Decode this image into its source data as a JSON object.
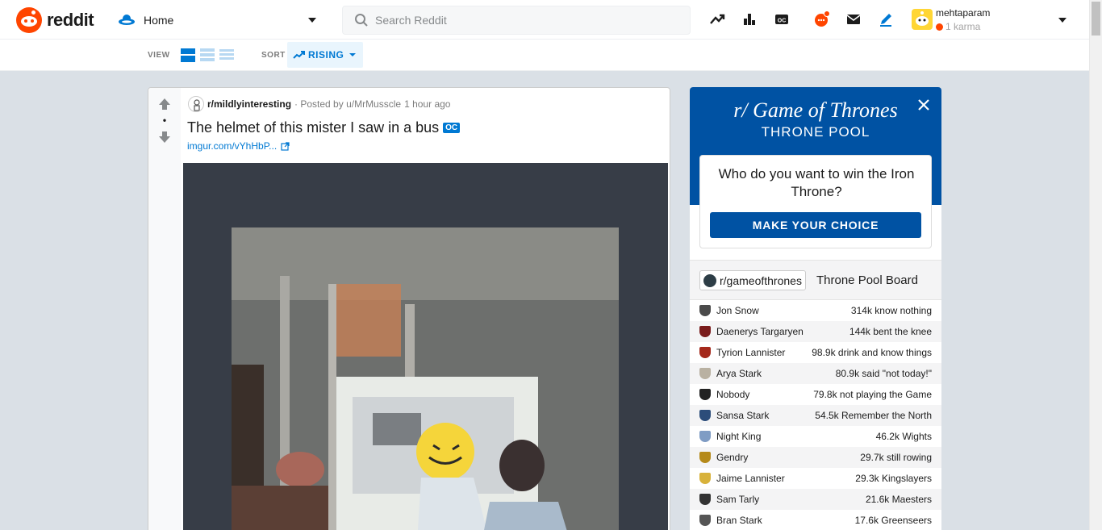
{
  "header": {
    "logo_text": "reddit",
    "home_label": "Home",
    "search_placeholder": "Search Reddit",
    "user": {
      "name": "mehtaparam",
      "karma": "1 karma"
    },
    "icons": [
      "popular-icon",
      "stats-icon",
      "oc-icon",
      "chat-icon",
      "mail-icon",
      "create-post-icon"
    ]
  },
  "subbar": {
    "view_label": "VIEW",
    "sort_label": "SORT",
    "sort_value": "RISING"
  },
  "post": {
    "score": "•",
    "subreddit": "r/mildlyinteresting",
    "posted_by": "· Posted by u/MrMusscle",
    "time": "1 hour ago",
    "title": "The helmet of this mister I saw in a bus",
    "flair": "OC",
    "link": "imgur.com/vYhHbP..."
  },
  "sidebar": {
    "banner_title": "r/ Game of Thrones",
    "banner_sub": "THRONE POOL",
    "question": "Who do you want to win the Iron Throne?",
    "choice_button": "MAKE YOUR CHOICE",
    "board_sub": "r/gameofthrones",
    "board_title": "Throne Pool Board",
    "rows": [
      {
        "name": "Jon Snow",
        "votes": "314k know nothing",
        "color": "#4a4a4a"
      },
      {
        "name": "Daenerys Targaryen",
        "votes": "144k bent the knee",
        "color": "#7a1c1c"
      },
      {
        "name": "Tyrion Lannister",
        "votes": "98.9k drink and know things",
        "color": "#a4281b"
      },
      {
        "name": "Arya Stark",
        "votes": "80.9k said \"not today!\"",
        "color": "#b9b1a2"
      },
      {
        "name": "Nobody",
        "votes": "79.8k not playing the Game",
        "color": "#222222"
      },
      {
        "name": "Sansa Stark",
        "votes": "54.5k Remember the North",
        "color": "#2c4d7a"
      },
      {
        "name": "Night King",
        "votes": "46.2k Wights",
        "color": "#7f9cc4"
      },
      {
        "name": "Gendry",
        "votes": "29.7k still rowing",
        "color": "#b58a1a"
      },
      {
        "name": "Jaime Lannister",
        "votes": "29.3k Kingslayers",
        "color": "#d8b23b"
      },
      {
        "name": "Sam Tarly",
        "votes": "21.6k Maesters",
        "color": "#333333"
      },
      {
        "name": "Bran Stark",
        "votes": "17.6k Greenseers",
        "color": "#555555"
      }
    ]
  },
  "colors": {
    "accent": "#0079d3",
    "brand": "#ff4500",
    "got_blue": "#0052a3"
  }
}
